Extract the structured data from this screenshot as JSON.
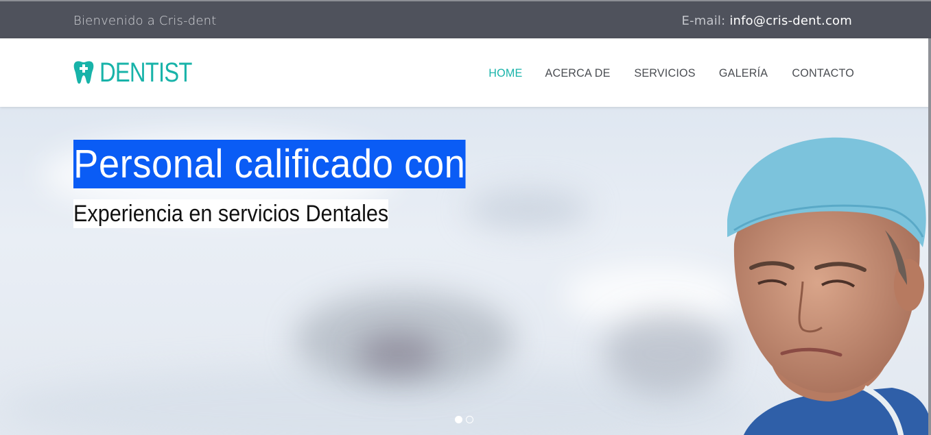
{
  "topbar": {
    "welcome": "Bienvenido a Cris-dent",
    "email_label": "E-mail:",
    "email_value": "info@cris-dent.com"
  },
  "brand": {
    "name": "DENTIST",
    "icon": "tooth-icon",
    "color": "#18b3a9"
  },
  "nav": {
    "items": [
      {
        "label": "HOME",
        "active": true
      },
      {
        "label": "ACERCA DE"
      },
      {
        "label": "SERVICIOS"
      },
      {
        "label": "GALERÍA"
      },
      {
        "label": "CONTACTO"
      }
    ]
  },
  "hero": {
    "headline": "Personal calificado con",
    "subline": "Experiencia en servicios Dentales",
    "headline_highlight": "#0a5cf5",
    "slides": 2,
    "active_slide": 1
  },
  "colors": {
    "topbar_bg": "#4f525c",
    "accent": "#18b3a9"
  }
}
